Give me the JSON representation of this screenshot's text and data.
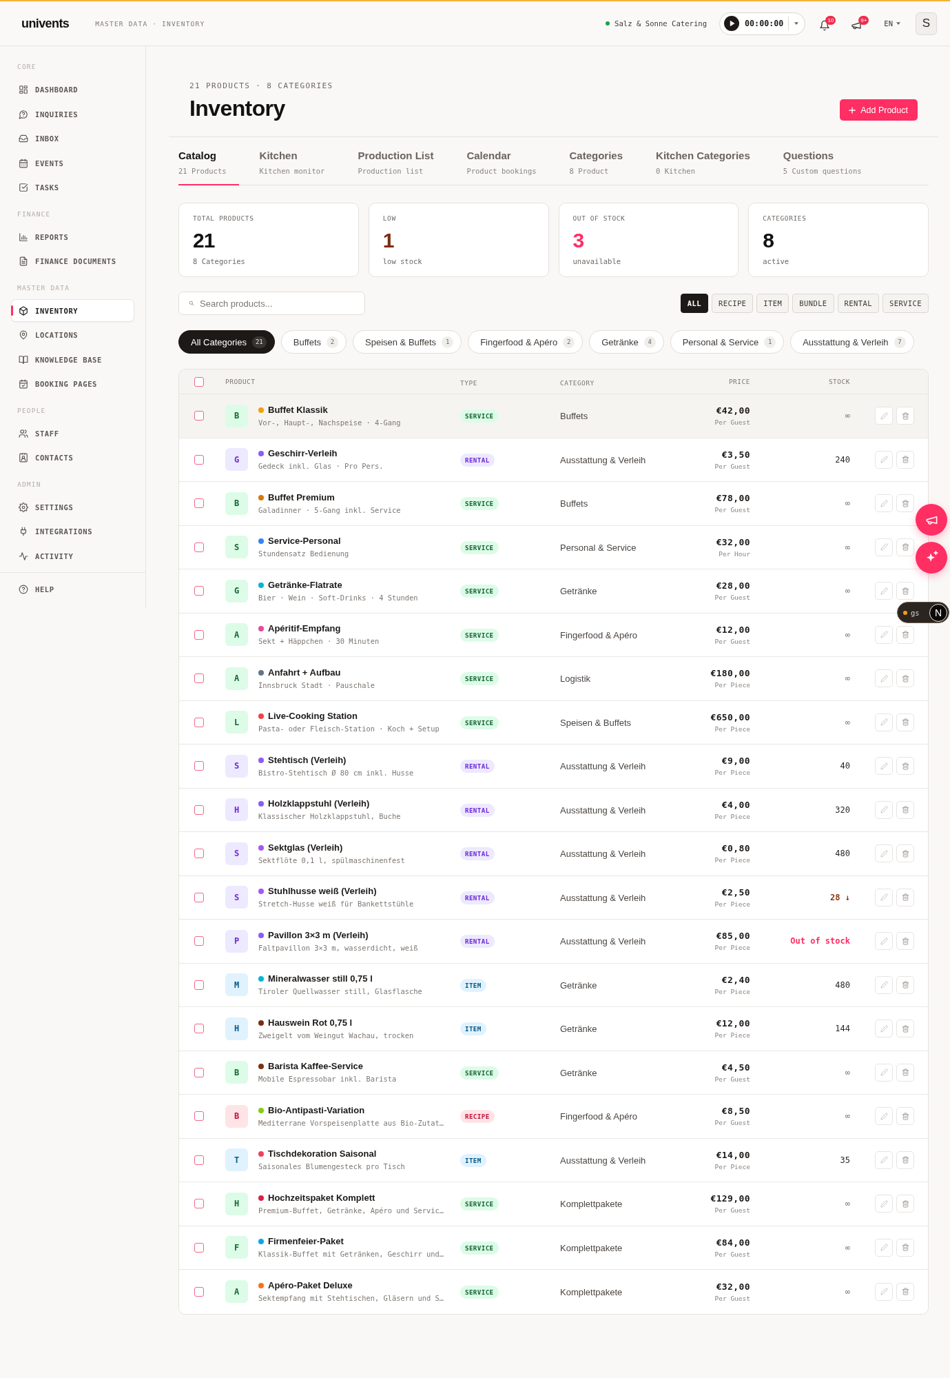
{
  "header": {
    "logo": "univents",
    "breadcrumb": "MASTER DATA · INVENTORY",
    "workspace": {
      "name": "Salz & Sonne Catering",
      "online": true
    },
    "timer": {
      "time": "00:00:00",
      "running": false
    },
    "notifications": {
      "count": "10"
    },
    "announcements": {
      "count": "9+"
    },
    "language": "EN",
    "avatar": "S"
  },
  "sidebar": {
    "sections": [
      {
        "title": "CORE",
        "items": [
          {
            "label": "DASHBOARD",
            "selected": false
          },
          {
            "label": "INQUIRIES",
            "selected": false
          },
          {
            "label": "INBOX",
            "selected": false
          },
          {
            "label": "EVENTS",
            "selected": false
          },
          {
            "label": "TASKS",
            "selected": false
          }
        ]
      },
      {
        "title": "FINANCE",
        "items": [
          {
            "label": "REPORTS",
            "selected": false
          },
          {
            "label": "FINANCE DOCUMENTS",
            "selected": false
          }
        ]
      },
      {
        "title": "MASTER DATA",
        "items": [
          {
            "label": "INVENTORY",
            "selected": true
          },
          {
            "label": "LOCATIONS",
            "selected": false
          },
          {
            "label": "KNOWLEDGE BASE",
            "selected": false
          },
          {
            "label": "BOOKING PAGES",
            "selected": false
          }
        ]
      },
      {
        "title": "PEOPLE",
        "items": [
          {
            "label": "STAFF",
            "selected": false
          },
          {
            "label": "CONTACTS",
            "selected": false
          }
        ]
      },
      {
        "title": "ADMIN",
        "items": [
          {
            "label": "SETTINGS",
            "selected": false
          },
          {
            "label": "INTEGRATIONS",
            "selected": false
          },
          {
            "label": "ACTIVITY",
            "selected": false
          }
        ]
      }
    ],
    "footer": [
      {
        "label": "HELP",
        "selected": false
      }
    ]
  },
  "page": {
    "summary": "21 PRODUCTS · 8 CATEGORIES",
    "title": "Inventory",
    "add_button": "Add Product"
  },
  "tabs": [
    {
      "label": "Catalog",
      "sub": "21 Products",
      "selected": true
    },
    {
      "label": "Kitchen",
      "sub": "Kitchen monitor",
      "selected": false
    },
    {
      "label": "Production List",
      "sub": "Production list",
      "selected": false
    },
    {
      "label": "Calendar",
      "sub": "Product bookings",
      "selected": false
    },
    {
      "label": "Categories",
      "sub": "8 Product",
      "selected": false
    },
    {
      "label": "Kitchen Categories",
      "sub": "0 Kitchen",
      "selected": false
    },
    {
      "label": "Questions",
      "sub": "5 Custom questions",
      "selected": false
    }
  ],
  "stats": [
    {
      "label": "TOTAL PRODUCTS",
      "value": "21",
      "sub": "8 Categories",
      "kind": "plain"
    },
    {
      "label": "LOW",
      "value": "1",
      "sub": "low stock",
      "kind": "warning"
    },
    {
      "label": "OUT OF STOCK",
      "value": "3",
      "sub": "unavailable",
      "kind": "danger"
    },
    {
      "label": "CATEGORIES",
      "value": "8",
      "sub": "active",
      "kind": "plain"
    }
  ],
  "search": {
    "placeholder": "Search products..."
  },
  "type_filters": [
    {
      "label": "ALL",
      "selected": true
    },
    {
      "label": "RECIPE",
      "selected": false
    },
    {
      "label": "ITEM",
      "selected": false
    },
    {
      "label": "BUNDLE",
      "selected": false
    },
    {
      "label": "RENTAL",
      "selected": false
    },
    {
      "label": "SERVICE",
      "selected": false
    }
  ],
  "category_chips": [
    {
      "label": "All Categories",
      "count": "21",
      "selected": true
    },
    {
      "label": "Buffets",
      "count": "2",
      "selected": false
    },
    {
      "label": "Speisen & Buffets",
      "count": "1",
      "selected": false
    },
    {
      "label": "Fingerfood & Apéro",
      "count": "2",
      "selected": false
    },
    {
      "label": "Getränke",
      "count": "4",
      "selected": false
    },
    {
      "label": "Personal & Service",
      "count": "1",
      "selected": false
    },
    {
      "label": "Ausstattung & Verleih",
      "count": "7",
      "selected": false
    }
  ],
  "table": {
    "columns": [
      "PRODUCT",
      "TYPE",
      "CATEGORY",
      "PRICE",
      "STOCK"
    ],
    "all_checked": false,
    "rows": [
      {
        "initial": "B",
        "color": "#f59e0b",
        "name": "Buffet Klassik",
        "description": "Vor-, Haupt-, Nachspeise · 4-Gang",
        "kind": "service",
        "type": "SERVICE",
        "category": "Buffets",
        "price": "€42,00",
        "unit": "Per Guest",
        "stock": {
          "value": "∞",
          "kind": "unlimited"
        },
        "checked": false,
        "highlighted": true
      },
      {
        "initial": "G",
        "color": "#8b5cf6",
        "name": "Geschirr-Verleih",
        "description": "Gedeck inkl. Glas · Pro Pers.",
        "kind": "rental",
        "type": "RENTAL",
        "category": "Ausstattung & Verleih",
        "price": "€3,50",
        "unit": "Per Guest",
        "stock": {
          "value": "240",
          "kind": "normal"
        },
        "checked": false,
        "highlighted": false
      },
      {
        "initial": "B",
        "color": "#d97706",
        "name": "Buffet Premium",
        "description": "Galadinner · 5-Gang inkl. Service",
        "kind": "service",
        "type": "SERVICE",
        "category": "Buffets",
        "price": "€78,00",
        "unit": "Per Guest",
        "stock": {
          "value": "∞",
          "kind": "unlimited"
        },
        "checked": false,
        "highlighted": false
      },
      {
        "initial": "S",
        "color": "#3b82f6",
        "name": "Service-Personal",
        "description": "Stundensatz Bedienung",
        "kind": "service",
        "type": "SERVICE",
        "category": "Personal & Service",
        "price": "€32,00",
        "unit": "Per Hour",
        "stock": {
          "value": "∞",
          "kind": "unlimited"
        },
        "checked": false,
        "highlighted": false
      },
      {
        "initial": "G",
        "color": "#06b6d4",
        "name": "Getränke-Flatrate",
        "description": "Bier · Wein · Soft-Drinks · 4 Stunden",
        "kind": "service",
        "type": "SERVICE",
        "category": "Getränke",
        "price": "€28,00",
        "unit": "Per Guest",
        "stock": {
          "value": "∞",
          "kind": "unlimited"
        },
        "checked": false,
        "highlighted": false
      },
      {
        "initial": "A",
        "color": "#ec4899",
        "name": "Apéritif-Empfang",
        "description": "Sekt + Häppchen · 30 Minuten",
        "kind": "service",
        "type": "SERVICE",
        "category": "Fingerfood & Apéro",
        "price": "€12,00",
        "unit": "Per Guest",
        "stock": {
          "value": "∞",
          "kind": "unlimited"
        },
        "checked": false,
        "highlighted": false
      },
      {
        "initial": "A",
        "color": "#64748b",
        "name": "Anfahrt + Aufbau",
        "description": "Innsbruck Stadt · Pauschale",
        "kind": "service",
        "type": "SERVICE",
        "category": "Logistik",
        "price": "€180,00",
        "unit": "Per Piece",
        "stock": {
          "value": "∞",
          "kind": "unlimited"
        },
        "checked": false,
        "highlighted": false
      },
      {
        "initial": "L",
        "color": "#ef4444",
        "name": "Live-Cooking Station",
        "description": "Pasta- oder Fleisch-Station · Koch + Setup",
        "kind": "service",
        "type": "SERVICE",
        "category": "Speisen & Buffets",
        "price": "€650,00",
        "unit": "Per Piece",
        "stock": {
          "value": "∞",
          "kind": "unlimited"
        },
        "checked": false,
        "highlighted": false
      },
      {
        "initial": "S",
        "color": "#8b5cf6",
        "name": "Stehtisch (Verleih)",
        "description": "Bistro-Stehtisch Ø 80 cm inkl. Husse",
        "kind": "rental",
        "type": "RENTAL",
        "category": "Ausstattung & Verleih",
        "price": "€9,00",
        "unit": "Per Piece",
        "stock": {
          "value": "40",
          "kind": "normal"
        },
        "checked": false,
        "highlighted": false
      },
      {
        "initial": "H",
        "color": "#8b5cf6",
        "name": "Holzklappstuhl (Verleih)",
        "description": "Klassischer Holzklappstuhl, Buche",
        "kind": "rental",
        "type": "RENTAL",
        "category": "Ausstattung & Verleih",
        "price": "€4,00",
        "unit": "Per Piece",
        "stock": {
          "value": "320",
          "kind": "normal"
        },
        "checked": false,
        "highlighted": false
      },
      {
        "initial": "S",
        "color": "#a855f7",
        "name": "Sektglas (Verleih)",
        "description": "Sektflöte 0,1 l, spülmaschinenfest",
        "kind": "rental",
        "type": "RENTAL",
        "category": "Ausstattung & Verleih",
        "price": "€0,80",
        "unit": "Per Piece",
        "stock": {
          "value": "480",
          "kind": "normal"
        },
        "checked": false,
        "highlighted": false
      },
      {
        "initial": "S",
        "color": "#a855f7",
        "name": "Stuhlhusse weiß (Verleih)",
        "description": "Stretch-Husse weiß für Bankettstühle",
        "kind": "rental",
        "type": "RENTAL",
        "category": "Ausstattung & Verleih",
        "price": "€2,50",
        "unit": "Per Piece",
        "stock": {
          "value": "28 ↓",
          "kind": "low"
        },
        "checked": false,
        "highlighted": false
      },
      {
        "initial": "P",
        "color": "#8b5cf6",
        "name": "Pavillon 3×3 m (Verleih)",
        "description": "Faltpavillon 3×3 m, wasserdicht, weiß",
        "kind": "rental",
        "type": "RENTAL",
        "category": "Ausstattung & Verleih",
        "price": "€85,00",
        "unit": "Per Piece",
        "stock": {
          "value": "Out of stock",
          "kind": "out"
        },
        "checked": false,
        "highlighted": false
      },
      {
        "initial": "M",
        "color": "#06b6d4",
        "name": "Mineralwasser still 0,75 l",
        "description": "Tiroler Quellwasser still, Glasflasche",
        "kind": "item",
        "type": "ITEM",
        "category": "Getränke",
        "price": "€2,40",
        "unit": "Per Piece",
        "stock": {
          "value": "480",
          "kind": "normal"
        },
        "checked": false,
        "highlighted": false
      },
      {
        "initial": "H",
        "color": "#7c2d12",
        "name": "Hauswein Rot 0,75 l",
        "description": "Zweigelt vom Weingut Wachau, trocken",
        "kind": "item",
        "type": "ITEM",
        "category": "Getränke",
        "price": "€12,00",
        "unit": "Per Piece",
        "stock": {
          "value": "144",
          "kind": "normal"
        },
        "checked": false,
        "highlighted": false
      },
      {
        "initial": "B",
        "color": "#78350f",
        "name": "Barista Kaffee-Service",
        "description": "Mobile Espressobar inkl. Barista",
        "kind": "service",
        "type": "SERVICE",
        "category": "Getränke",
        "price": "€4,50",
        "unit": "Per Guest",
        "stock": {
          "value": "∞",
          "kind": "unlimited"
        },
        "checked": false,
        "highlighted": false
      },
      {
        "initial": "B",
        "color": "#84cc16",
        "name": "Bio-Antipasti-Variation",
        "description": "Mediterrane Vorspeisenplatte aus Bio-Zutat…",
        "kind": "recipe",
        "type": "RECIPE",
        "category": "Fingerfood & Apéro",
        "price": "€8,50",
        "unit": "Per Guest",
        "stock": {
          "value": "∞",
          "kind": "unlimited"
        },
        "checked": false,
        "highlighted": false
      },
      {
        "initial": "T",
        "color": "#f43f5e",
        "name": "Tischdekoration Saisonal",
        "description": "Saisonales Blumengesteck pro Tisch",
        "kind": "item",
        "type": "ITEM",
        "category": "Ausstattung & Verleih",
        "price": "€14,00",
        "unit": "Per Piece",
        "stock": {
          "value": "35",
          "kind": "normal"
        },
        "checked": false,
        "highlighted": false
      },
      {
        "initial": "H",
        "color": "#e11d48",
        "name": "Hochzeitspaket Komplett",
        "description": "Premium-Buffet, Getränke, Apéro und Servic…",
        "kind": "service",
        "type": "SERVICE",
        "category": "Komplettpakete",
        "price": "€129,00",
        "unit": "Per Guest",
        "stock": {
          "value": "∞",
          "kind": "unlimited"
        },
        "checked": false,
        "highlighted": false
      },
      {
        "initial": "F",
        "color": "#0ea5e9",
        "name": "Firmenfeier-Paket",
        "description": "Klassik-Buffet mit Getränken, Geschirr und…",
        "kind": "service",
        "type": "SERVICE",
        "category": "Komplettpakete",
        "price": "€84,00",
        "unit": "Per Guest",
        "stock": {
          "value": "∞",
          "kind": "unlimited"
        },
        "checked": false,
        "highlighted": false
      },
      {
        "initial": "A",
        "color": "#f97316",
        "name": "Apéro-Paket Deluxe",
        "description": "Sektempfang mit Stehtischen, Gläsern und S…",
        "kind": "service",
        "type": "SERVICE",
        "category": "Komplettpakete",
        "price": "€32,00",
        "unit": "Per Guest",
        "stock": {
          "value": "∞",
          "kind": "unlimited"
        },
        "checked": false,
        "highlighted": false
      }
    ]
  },
  "dev_indicator": {
    "label": "gs",
    "logo": "N"
  }
}
